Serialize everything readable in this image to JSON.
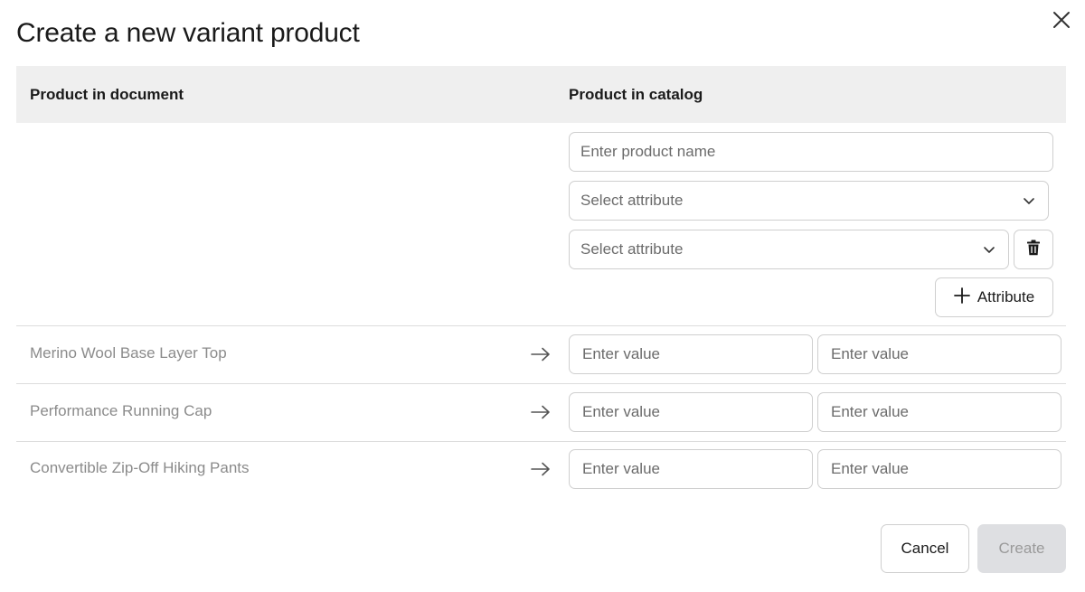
{
  "dialog": {
    "title": "Create a new variant product",
    "close_icon": "close-icon"
  },
  "table": {
    "headers": {
      "document": "Product in document",
      "catalog": "Product in catalog"
    }
  },
  "catalog_form": {
    "product_name_placeholder": "Enter product name",
    "attribute_selects": [
      {
        "placeholder": "Select attribute",
        "icon": "chevron-down-icon"
      },
      {
        "placeholder": "Select attribute",
        "icon": "chevron-down-icon",
        "delete_icon": "trash-icon"
      }
    ],
    "add_attribute_label": "Attribute",
    "add_attribute_icon": "plus-icon"
  },
  "rows": [
    {
      "document_product": "Merino Wool Base Layer Top",
      "value_placeholders": [
        "Enter value",
        "Enter value"
      ]
    },
    {
      "document_product": "Performance Running Cap",
      "value_placeholders": [
        "Enter value",
        "Enter value"
      ]
    },
    {
      "document_product": "Convertible Zip-Off Hiking Pants",
      "value_placeholders": [
        "Enter value",
        "Enter value"
      ]
    }
  ],
  "footer": {
    "cancel_label": "Cancel",
    "create_label": "Create",
    "create_disabled": true
  },
  "colors": {
    "header_bg": "#efefef",
    "border": "#cfcfcf",
    "muted_text": "#8b8b8b",
    "disabled_button_bg": "#dedfe2"
  }
}
